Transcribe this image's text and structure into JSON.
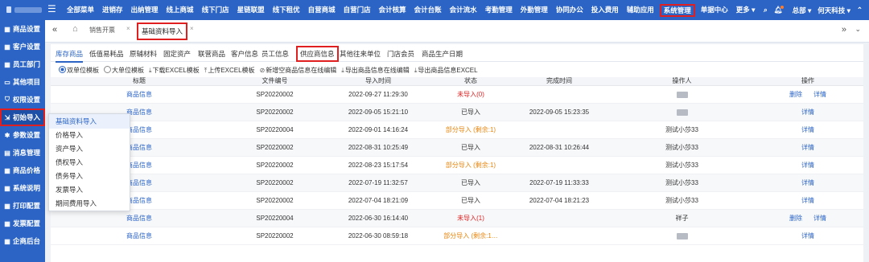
{
  "topbar": {
    "nav": [
      "全部菜单",
      "进销存",
      "出纳管理",
      "线上商城",
      "线下门店",
      "星链联盟",
      "线下租优",
      "自营商城",
      "自营门店",
      "会计核算",
      "会计台账",
      "会计流水",
      "考勤管理",
      "外勤管理",
      "协同办公",
      "投入费用",
      "辅助应用",
      "系统管理",
      "单据中心",
      "更多 ▾"
    ],
    "active_nav": "系统管理",
    "user": "总部 ▾",
    "company": "何天科技 ▾"
  },
  "sidebar": {
    "items": [
      {
        "label": "商品设置",
        "icon": "grid-icon"
      },
      {
        "label": "客户设置",
        "icon": "grid-icon"
      },
      {
        "label": "员工部门",
        "icon": "grid-icon"
      },
      {
        "label": "其他项目",
        "icon": "folder-icon"
      },
      {
        "label": "权限设置",
        "icon": "shield-icon"
      },
      {
        "label": "初始导入",
        "icon": "import-icon"
      },
      {
        "label": "参数设置",
        "icon": "gear-icon"
      },
      {
        "label": "消息管理",
        "icon": "message-icon"
      },
      {
        "label": "商品价格",
        "icon": "grid-icon"
      },
      {
        "label": "系统说明",
        "icon": "grid-icon"
      },
      {
        "label": "打印配置",
        "icon": "grid-icon"
      },
      {
        "label": "发票配置",
        "icon": "grid-icon"
      },
      {
        "label": "企商后台",
        "icon": "grid-icon"
      }
    ],
    "active_index": 5
  },
  "tabs": {
    "tab1": "销售开票",
    "tab2": "基础资料导入"
  },
  "subtabs": [
    "库存商品",
    "低值易耗品",
    "原辅材料",
    "固定资产",
    "联营商品",
    "客户信息",
    "员工信息",
    "供应商信息",
    "其他往来单位",
    "门店会员",
    "商品生产日期"
  ],
  "active_subtab": "库存商品",
  "boxed_subtab": "供应商信息",
  "toolbar": {
    "radio_single": "双单位模板",
    "radio_multi": "大单位模板",
    "download_excel": "下载EXCEL模板",
    "upload_excel": "上传EXCEL模板",
    "new_empty": "新增空商品信息在线编辑",
    "export_edit": "导出商品信息在线编辑",
    "export_excel": "导出商品信息EXCEL"
  },
  "table": {
    "headers": [
      "标题",
      "文件编号",
      "导入时间",
      "状态",
      "完成时间",
      "操作人",
      "操作"
    ],
    "rows": [
      {
        "title": "商品信息",
        "file": "SP20220002",
        "time": "2022-09-27 11:29:30",
        "status": "未导入(0)",
        "status_color": "red",
        "done": "",
        "op": "",
        "actions": [
          "删除",
          "详情"
        ]
      },
      {
        "title": "商品信息",
        "file": "SP20220002",
        "time": "2022-09-05 15:21:10",
        "status": "已导入",
        "status_color": "",
        "done": "2022-09-05 15:23:35",
        "op": "",
        "actions": [
          "详情"
        ]
      },
      {
        "title": "商品信息",
        "file": "SP20220004",
        "time": "2022-09-01 14:16:24",
        "status": "部分导入 (剩余:1)",
        "status_color": "orange",
        "done": "",
        "op": "测试小莎33",
        "actions": [
          "详情"
        ]
      },
      {
        "title": "商品信息",
        "file": "SP20220002",
        "time": "2022-08-31 10:25:49",
        "status": "已导入",
        "status_color": "",
        "done": "2022-08-31 10:26:44",
        "op": "测试小莎33",
        "actions": [
          "详情"
        ]
      },
      {
        "title": "商品信息",
        "file": "SP20220002",
        "time": "2022-08-23 15:17:54",
        "status": "部分导入 (剩余:1)",
        "status_color": "orange",
        "done": "",
        "op": "测试小莎33",
        "actions": [
          "详情"
        ]
      },
      {
        "title": "商品信息",
        "file": "SP20220002",
        "time": "2022-07-19 11:32:57",
        "status": "已导入",
        "status_color": "",
        "done": "2022-07-19 11:33:33",
        "op": "测试小莎33",
        "actions": [
          "详情"
        ]
      },
      {
        "title": "商品信息",
        "file": "SP20220002",
        "time": "2022-07-04 18:21:09",
        "status": "已导入",
        "status_color": "",
        "done": "2022-07-04 18:21:23",
        "op": "测试小莎33",
        "actions": [
          "详情"
        ]
      },
      {
        "title": "商品信息",
        "file": "SP20220004",
        "time": "2022-06-30 16:14:40",
        "status": "未导入(1)",
        "status_color": "red",
        "done": "",
        "op": "祥子",
        "actions": [
          "删除",
          "详情"
        ]
      },
      {
        "title": "商品信息",
        "file": "SP20220002",
        "time": "2022-06-30 08:59:18",
        "status": "部分导入 (剩余:1…",
        "status_color": "orange",
        "done": "",
        "op": "",
        "actions": [
          "详情"
        ]
      }
    ]
  },
  "dropdown": {
    "title": "基础资料导入",
    "items": [
      "价格导入",
      "资产导入",
      "债权导入",
      "债务导入",
      "发票导入",
      "期间费用导入"
    ]
  },
  "colors": {
    "brand": "#2b64c5",
    "highlight": "#e02020",
    "warning": "#e9850c"
  }
}
